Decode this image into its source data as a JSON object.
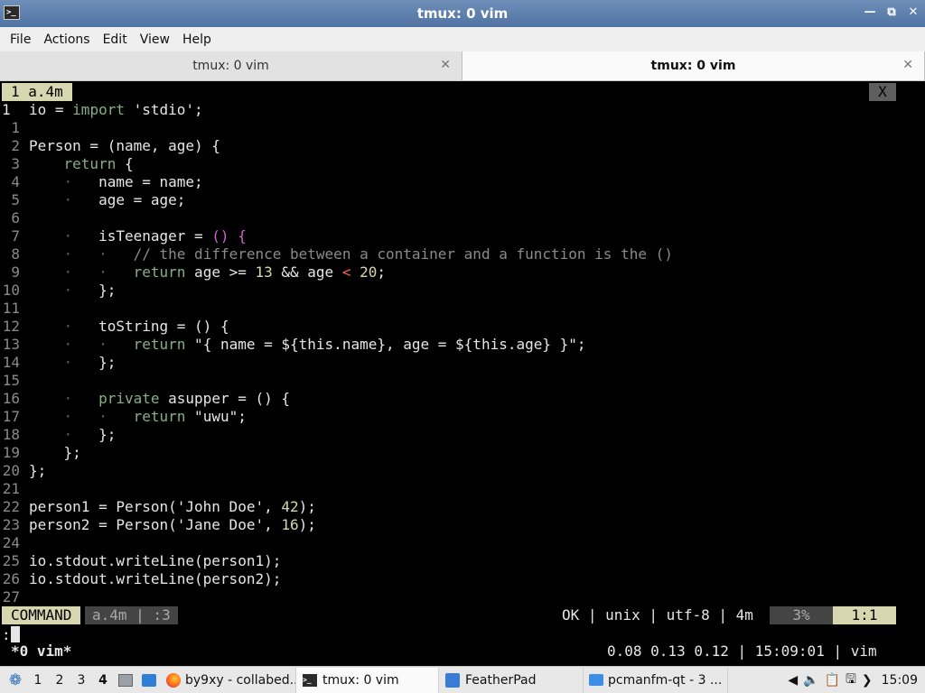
{
  "window": {
    "title": "tmux: 0 vim",
    "icon_label": ">_"
  },
  "menu": [
    "File",
    "Actions",
    "Edit",
    "View",
    "Help"
  ],
  "tabs": [
    {
      "label": "tmux: 0 vim",
      "active": false
    },
    {
      "label": "tmux: 0 vim",
      "active": true
    }
  ],
  "vim": {
    "tabline_label": "1  a.4m",
    "tabline_close": "X",
    "lines": [
      [
        "1",
        "io = import 'stdio';"
      ],
      [
        "1",
        ""
      ],
      [
        "2",
        "Person = (name, age) {"
      ],
      [
        "3",
        "return {"
      ],
      [
        "4",
        "name = name;"
      ],
      [
        "5",
        "age = age;"
      ],
      [
        "6",
        ""
      ],
      [
        "7",
        "isTeenager = () {"
      ],
      [
        "8",
        "// the difference between a container and a function is the ()"
      ],
      [
        "9",
        "return age >= 13 && age < 20;"
      ],
      [
        "10",
        "};"
      ],
      [
        "11",
        ""
      ],
      [
        "12",
        "toString = () {"
      ],
      [
        "13",
        "return \"{ name = ${this.name}, age = ${this.age} }\";"
      ],
      [
        "14",
        "};"
      ],
      [
        "15",
        ""
      ],
      [
        "16",
        "private asupper = () {"
      ],
      [
        "17",
        "return \"uwu\";"
      ],
      [
        "18",
        "};"
      ],
      [
        "19",
        "};"
      ],
      [
        "20",
        "};"
      ],
      [
        "21",
        ""
      ],
      [
        "22",
        "person1 = Person('John Doe', 42);"
      ],
      [
        "23",
        "person2 = Person('Jane Doe', 16);"
      ],
      [
        "24",
        ""
      ],
      [
        "25",
        "io.stdout.writeLine(person1);"
      ],
      [
        "26",
        "io.stdout.writeLine(person2);"
      ],
      [
        "27",
        ""
      ]
    ],
    "status": {
      "mode": "COMMAND",
      "file": "a.4m  | :3",
      "info": "OK  |  unix  |  utf-8  |  4m",
      "percent": "3%",
      "position": "1:1"
    },
    "cmdline": ":"
  },
  "tmux": {
    "left": "*0 vim*",
    "right": "0.08 0.13 0.12 | 15:09:01 | vim"
  },
  "taskbar": {
    "workspaces": [
      "1",
      "2",
      "3",
      "4"
    ],
    "active_workspace": "4",
    "tasks": [
      {
        "label": "by9xy - collabed...",
        "icon": "firefox-icon"
      },
      {
        "label": "tmux: 0 vim",
        "icon": "terminal-icon"
      },
      {
        "label": "FeatherPad",
        "icon": "featherpad-icon"
      },
      {
        "label": "pcmanfm-qt - 3 ...",
        "icon": "folder-icon"
      }
    ],
    "clock": "15:09"
  }
}
